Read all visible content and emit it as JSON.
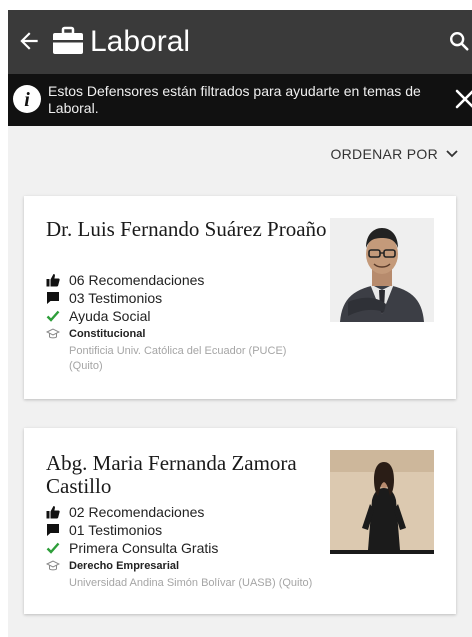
{
  "header": {
    "title": "Laboral",
    "back_icon": "arrow-left-icon",
    "category_icon": "briefcase-icon",
    "search_icon": "search-icon",
    "background": "#3a3a3a"
  },
  "notice": {
    "text": "Estos Defensores están filtrados para ayudarte en temas de Laboral.",
    "info_icon": "info-icon",
    "close_icon": "close-icon"
  },
  "sort": {
    "label": "ORDENAR POR",
    "icon": "chevron-down-icon"
  },
  "lawyers": [
    {
      "name": "Dr. Luis Fernando Suárez Proaño",
      "recommendations": "06 Recomendaciones",
      "testimonials": "03 Testimonios",
      "feature": "Ayuda Social",
      "specialty": "Constitucional",
      "institution": "Pontificia Univ. Católica del Ecuador (PUCE) (Quito)"
    },
    {
      "name": "Abg. Maria Fernanda Zamora Castillo",
      "recommendations": "02 Recomendaciones",
      "testimonials": "01 Testimonios",
      "feature": "Primera Consulta Gratis",
      "specialty": "Derecho Empresarial",
      "institution": "Universidad Andina Simón Bolívar (UASB) (Quito)"
    }
  ],
  "colors": {
    "check": "#2e9e3a",
    "notice_bg": "#111111"
  }
}
